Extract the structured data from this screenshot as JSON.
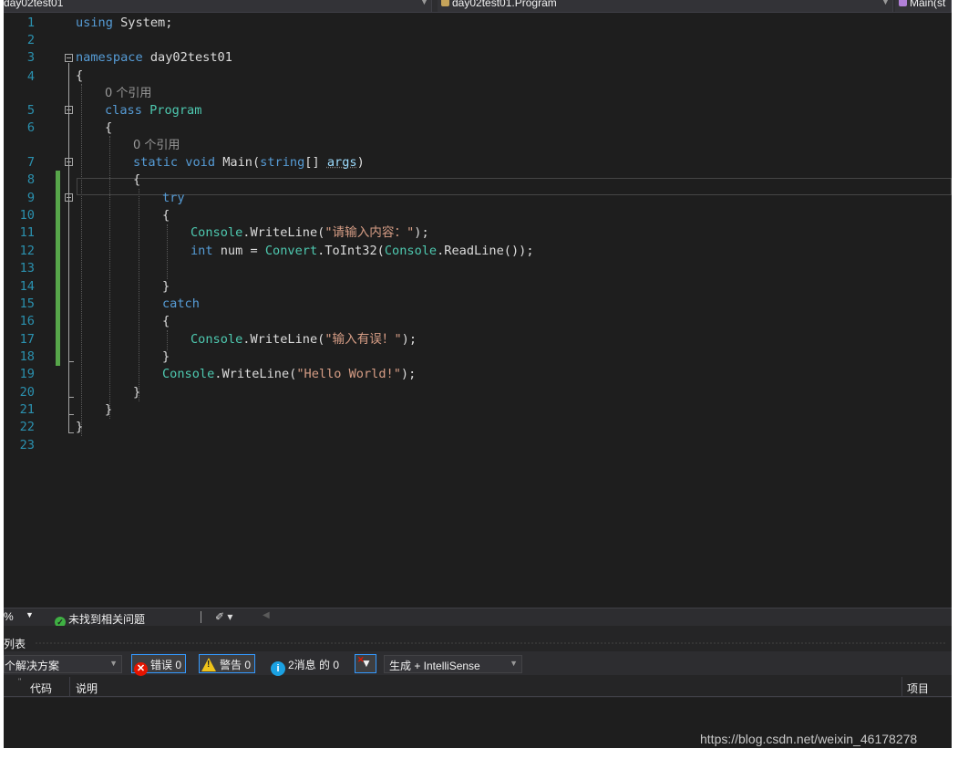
{
  "navbar": {
    "project": "day02test01",
    "class_scope": "day02test01.Program",
    "member_scope": "Main(st"
  },
  "editor": {
    "line_numbers": [
      "1",
      "2",
      "3",
      "4",
      "5",
      "6",
      "7",
      "8",
      "9",
      "10",
      "11",
      "12",
      "13",
      "14",
      "15",
      "16",
      "17",
      "18",
      "19",
      "20",
      "21",
      "22",
      "23"
    ],
    "codelens_references": "0 个引用",
    "code": {
      "l1_kw": "using",
      "l1_rest": " System;",
      "l3_kw": "namespace",
      "l3_rest": " day02test01",
      "brace_open": "{",
      "brace_close": "}",
      "l5_kw": "class",
      "l5_type": "Program",
      "l7_kw1": "static",
      "l7_kw2": "void",
      "l7_method": "Main(",
      "l7_kw3": "string",
      "l7_arr": "[] ",
      "l7_param": "args",
      "l7_close": ")",
      "try_kw": "try",
      "console": "Console",
      "writeline": ".WriteLine(",
      "call_end": ");",
      "l11_str": "\"请输入内容：\"",
      "l12_kw": "int",
      "l12_mid": " num = ",
      "l12_type1": "Convert",
      "l12_method": ".ToInt32(",
      "l12_type2": "Console",
      "l12_end": ".ReadLine());",
      "catch_kw": "catch",
      "l17_str": "\"输入有误！\"",
      "l19_str": "\"Hello World!\""
    }
  },
  "status_strip": {
    "zoom": "%",
    "issues": "未找到相关问题",
    "brush": "✐ ▾",
    "scroll_left": "◀"
  },
  "error_list": {
    "title": "列表",
    "scope": "个解决方案",
    "errors": "错误 0",
    "warnings": "警告 0",
    "messages": "2消息 的 0",
    "build_filter": "生成 + IntelliSense",
    "columns": {
      "code": "代码",
      "description": "说明",
      "project": "项目"
    }
  },
  "watermark": "https://blog.csdn.net/weixin_46178278"
}
